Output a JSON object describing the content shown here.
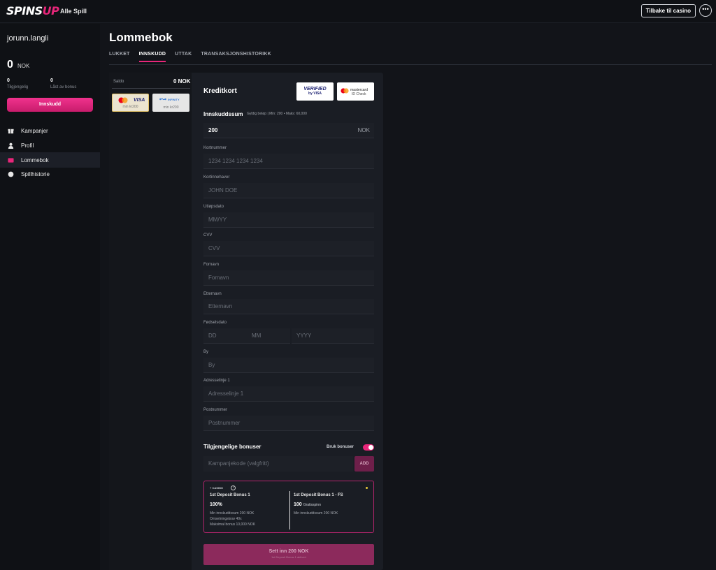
{
  "header": {
    "logo_part1": "SPINS",
    "logo_part2": "UP",
    "nav_all_games": "Alle Spill",
    "back_button": "Tilbake til casino",
    "more_button": "•••"
  },
  "sidebar": {
    "username": "jorunn.langli",
    "balance": "0",
    "currency": "NOK",
    "available_value": "0",
    "available_label": "Tilgjengelig",
    "bonus_value": "0",
    "bonus_label": "Låst av bonus",
    "deposit_button": "Innskudd",
    "menu": [
      {
        "label": "Kampanjer",
        "icon": "gift-icon"
      },
      {
        "label": "Profil",
        "icon": "user-icon"
      },
      {
        "label": "Lommebok",
        "icon": "wallet-icon",
        "active": true
      },
      {
        "label": "Spillhistorie",
        "icon": "history-icon"
      }
    ]
  },
  "main": {
    "title": "Lommebok",
    "tabs": [
      "LUKKET",
      "INNSKUDD",
      "UTTAK",
      "TRANSAKSJONSHISTORIKK"
    ],
    "active_tab": "INNSKUDD"
  },
  "methods": {
    "saldo_label": "Saldo",
    "saldo_value": "0 NOK",
    "items": [
      {
        "name": "mastercard-visa",
        "brand": "VISA",
        "min": "min kr200"
      },
      {
        "name": "payment-infinity",
        "brand": "INFINITY",
        "min": "min kr200"
      }
    ]
  },
  "form": {
    "title": "Kreditkort",
    "badge_visa_line1": "VERIFIED",
    "badge_visa_line2": "by VISA",
    "badge_mc_line1": "mastercard",
    "badge_mc_line2": "ID Check",
    "amount_title": "Innskuddssum",
    "amount_hint": "Gyldig beløp | Min: 200 • Maks: 60,000",
    "amount_value": "200",
    "amount_currency": "NOK",
    "card_number_label": "Kortnummer",
    "card_number_ph": "1234 1234 1234 1234",
    "card_holder_label": "Kortinnehaver",
    "card_holder_ph": "JOHN DOE",
    "expiry_label": "Utløpsdato",
    "expiry_ph": "MM/YY",
    "cvv_label": "CVV",
    "cvv_ph": "CVV",
    "firstname_label": "Fornavn",
    "firstname_ph": "Fornavn",
    "lastname_label": "Etternavn",
    "lastname_ph": "Etternavn",
    "birth_label": "Fødselsdato",
    "birth_dd": "DD",
    "birth_mm": "MM",
    "birth_yyyy": "YYYY",
    "city_label": "By",
    "city_ph": "By",
    "address_label": "Adresselinje 1",
    "address_ph": "Adresselinje 1",
    "postal_label": "Postnummer",
    "postal_ph": "Postnummer"
  },
  "bonuses": {
    "title": "Tilgjengelige bonuser",
    "use_label": "Bruk bonuser",
    "promo_placeholder": "Kampanjekode (valgfritt)",
    "add_button": "ADD",
    "casino_tag": "+ CASINO",
    "bonus1": {
      "name": "1st Deposit Bonus 1",
      "value": "100%",
      "detail1": "Min innskuddssum 200 NOK",
      "detail2": "Omsetningskrav 40x",
      "detail3": "Maksimal bonus 10,000 NOK"
    },
    "bonus2": {
      "name": "1st Deposit Bonus 1 - FS",
      "value": "100",
      "unit": "Gratisspinn",
      "detail1": "Min innskuddssum 200 NOK"
    },
    "submit_line1": "Sett inn 200 NOK",
    "submit_line2": "1st Deposit Bonus 1 aktivert"
  },
  "colors": {
    "accent": "#e8267a",
    "background": "#121419",
    "card": "#1a1d24"
  }
}
